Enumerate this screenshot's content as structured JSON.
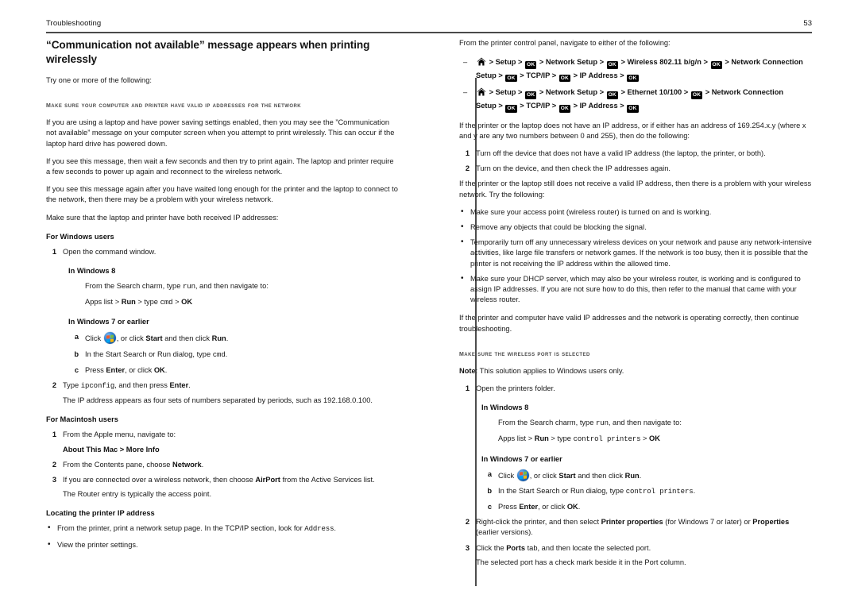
{
  "header": {
    "title": "Troubleshooting",
    "page_number": "53"
  },
  "icons": {
    "home": "home-icon",
    "ok": "OK",
    "windows_orb": "windows-start-orb-icon"
  },
  "left_column": {
    "title": "“Communication not available” message appears when printing wirelessly",
    "intro": "Try one or more of the following:",
    "section_head": "Make sure your computer and printer have valid IP addresses for the network",
    "paragraphs": [
      "If you are using a laptop and have power saving settings enabled, then you may see the ”Communication not available” message on your computer screen when you attempt to print wirelessly. This can occur if the laptop hard drive has powered down.",
      "If you see this message, then wait a few seconds and then try to print again. The laptop and printer require a few seconds to power up again and reconnect to the wireless network.",
      "If you see this message again after you have waited long enough for the printer and the laptop to connect to the network, then there may be a problem with your wireless network.",
      "Make sure that the laptop and printer have both received IP addresses:"
    ],
    "windows_users": {
      "heading": "For Windows users",
      "step1_marker": "1",
      "step1_text": "Open the command window.",
      "win8_heading": "In Windows 8",
      "win8_line1": "From the Search charm, type run, and then navigate to:",
      "win8_line1_code": "run",
      "win8_path_pre": "Apps list > ",
      "win8_path_run": "Run",
      "win8_path_mid": " > type ",
      "win8_path_code": "cmd",
      "win8_path_sep": " > ",
      "win8_path_ok": "OK",
      "win7_heading": "In Windows 7 or earlier",
      "sub_a_marker": "a",
      "sub_a_pre": "Click ",
      "sub_a_mid": ", or click ",
      "sub_a_start": "Start",
      "sub_a_mid2": " and then click ",
      "sub_a_run": "Run",
      "sub_a_end": ".",
      "sub_b_marker": "b",
      "sub_b_pre": "In the Start Search or Run dialog, type ",
      "sub_b_code": "cmd",
      "sub_b_end": ".",
      "sub_c_marker": "c",
      "sub_c_pre": "Press ",
      "sub_c_enter": "Enter",
      "sub_c_mid": ", or click ",
      "sub_c_ok": "OK",
      "sub_c_end": ".",
      "step2_marker": "2",
      "step2_pre": "Type ",
      "step2_code": "ipconfig",
      "step2_mid": ", and then press ",
      "step2_enter": "Enter",
      "step2_end": ".",
      "step2_note": "The IP address appears as four sets of numbers separated by periods, such as 192.168.0.100."
    },
    "macintosh_users": {
      "heading": "For Macintosh users",
      "step1_marker": "1",
      "step1_text": "From the Apple menu, navigate to:",
      "step1_path": "About This Mac > More Info",
      "step2_marker": "2",
      "step2_pre": "From the Contents pane, choose ",
      "step2_bold": "Network",
      "step2_end": ".",
      "step3_marker": "3",
      "step3_pre": "If you are connected over a wireless network, then choose ",
      "step3_bold": "AirPort",
      "step3_end": " from the Active Services list.",
      "step3_note": "The Router entry is typically the access point."
    },
    "locating_ip": {
      "heading": "Locating the printer IP address",
      "bullet1": "From the printer, print a network setup page.",
      "bullet1_note_pre": "In the TCP/IP section, look for ",
      "bullet1_note_code": "Address",
      "bullet1_note_end": ".",
      "bullet2": "View the printer settings."
    }
  },
  "right_column": {
    "intro": "From the printer control panel, navigate to either of the following:",
    "nav_path_1": {
      "line1": [
        {
          "type": "icon",
          "value": "home"
        },
        {
          "type": "text",
          "value": " > Setup > "
        },
        {
          "type": "ok"
        },
        {
          "type": "text",
          "value": " > Network Setup > "
        },
        {
          "type": "ok"
        },
        {
          "type": "text",
          "value": " > Wireless 802.11 b/g/n > "
        },
        {
          "type": "ok"
        },
        {
          "type": "text",
          "value": " > Network Connection"
        }
      ],
      "line2": [
        {
          "type": "text",
          "value": "Setup > "
        },
        {
          "type": "ok"
        },
        {
          "type": "text",
          "value": " > TCP/IP > "
        },
        {
          "type": "ok"
        },
        {
          "type": "text",
          "value": " > IP Address > "
        },
        {
          "type": "ok"
        }
      ]
    },
    "nav_path_2": {
      "line1": [
        {
          "type": "icon",
          "value": "home"
        },
        {
          "type": "text",
          "value": " > Setup > "
        },
        {
          "type": "ok"
        },
        {
          "type": "text",
          "value": " > Network Setup > "
        },
        {
          "type": "ok"
        },
        {
          "type": "text",
          "value": " > Ethernet 10/100 > "
        },
        {
          "type": "ok"
        },
        {
          "type": "text",
          "value": " > Network Connection"
        }
      ],
      "line2": [
        {
          "type": "text",
          "value": "Setup > "
        },
        {
          "type": "ok"
        },
        {
          "type": "text",
          "value": " > TCP/IP > "
        },
        {
          "type": "ok"
        },
        {
          "type": "text",
          "value": " > IP Address > "
        },
        {
          "type": "ok"
        }
      ]
    },
    "para_169": "If the printer or the laptop does not have an IP address, or if either has an address of 169.254.x.y (where x and y are any two numbers between 0 and 255), then do the following:",
    "step1_marker": "1",
    "step1_text": "Turn off the device that does not have a valid IP address (the laptop, the printer, or both).",
    "step2_marker": "2",
    "step2_text": "Turn on the device, and then check the IP addresses again.",
    "para_still": "If the printer or the laptop still does not receive a valid IP address, then there is a problem with your wireless network. Try the following:",
    "bullets": [
      "Make sure your access point (wireless router) is turned on and is working.",
      "Remove any objects that could be blocking the signal.",
      "Temporarily turn off any unnecessary wireless devices on your network and pause any network-intensive activities, like large file transfers or network games. If the network is too busy, then it is possible that the printer is not receiving the IP address within the allowed time.",
      "Make sure your DHCP server, which may also be your wireless router, is working and is configured to assign IP addresses. If you are not sure how to do this, then refer to the manual that came with your wireless router."
    ],
    "para_valid": "If the printer and computer have valid IP addresses and the network is operating correctly, then continue troubleshooting.",
    "section_head": "Make sure the wireless port is selected",
    "note_label": "Note",
    "note_text": ": This solution applies to Windows users only.",
    "step_open_marker": "1",
    "step_open_text": "Open the printers folder.",
    "win8_heading": "In Windows 8",
    "win8_line1_pre": "From the Search charm, type ",
    "win8_line1_code": "run",
    "win8_line1_end": ", and then navigate to:",
    "win8_path_pre": "Apps list > ",
    "win8_path_run": "Run",
    "win8_path_mid": " > type ",
    "win8_path_code": "control printers",
    "win8_path_sep": " > ",
    "win8_path_ok": "OK",
    "win7_heading": "In Windows 7 or earlier",
    "sub_a_marker": "a",
    "sub_a_pre": "Click ",
    "sub_a_mid": ", or click ",
    "sub_a_start": "Start",
    "sub_a_mid2": " and then click ",
    "sub_a_run": "Run",
    "sub_a_end": ".",
    "sub_b_marker": "b",
    "sub_b_pre": "In the Start Search or Run dialog, type ",
    "sub_b_code": "control printers",
    "sub_b_end": ".",
    "sub_c_marker": "c",
    "sub_c_pre": "Press ",
    "sub_c_enter": "Enter",
    "sub_c_mid": ", or click ",
    "sub_c_ok": "OK",
    "sub_c_end": ".",
    "step2_pre": "Right-click the printer, and then select ",
    "step2_bold1": "Printer properties",
    "step2_mid": " (for Windows 7 or later) or ",
    "step2_bold2": "Properties",
    "step2_end": " (earlier versions).",
    "step3_marker": "3",
    "step3_pre": "Click the ",
    "step3_bold": "Ports",
    "step3_end": " tab, and then locate the selected port.",
    "step3_note": "The selected port has a check mark beside it in the Port column."
  }
}
